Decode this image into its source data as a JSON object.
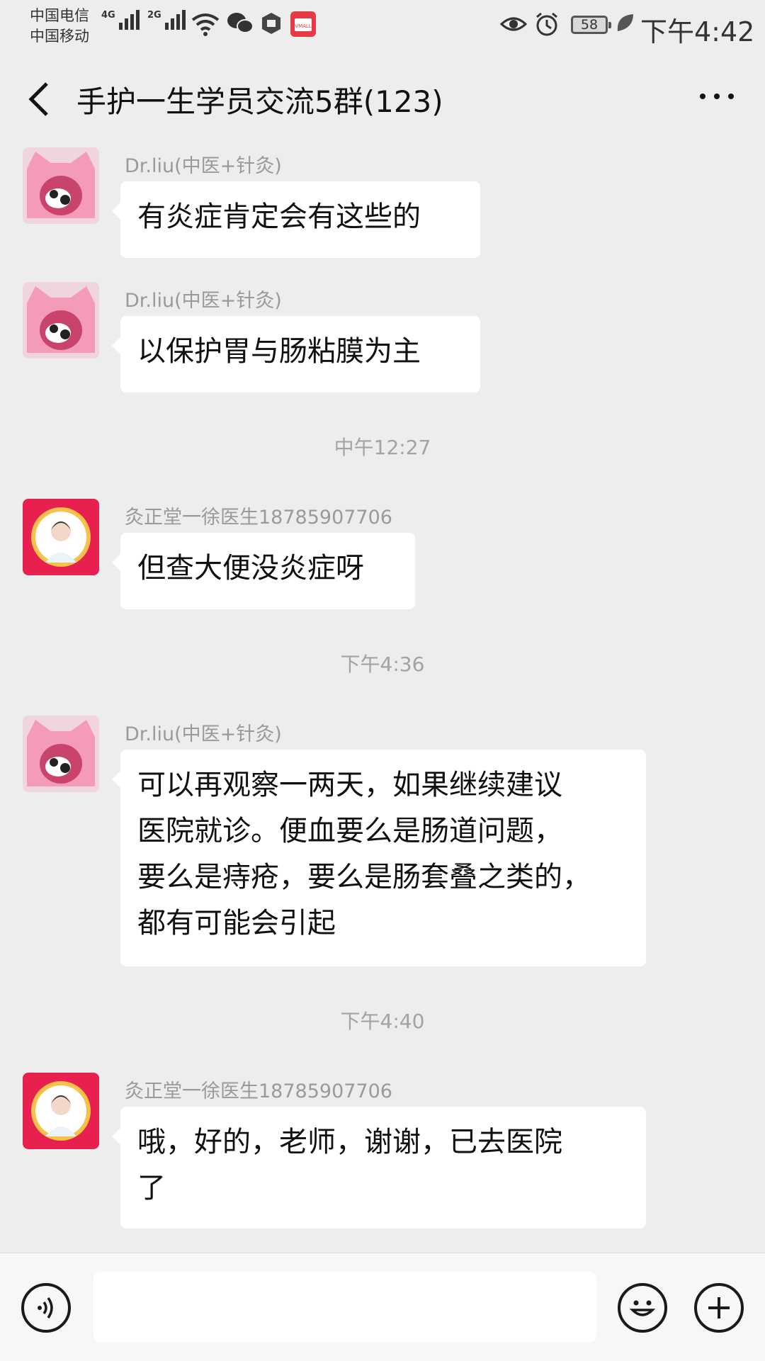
{
  "status_bar": {
    "carrier_1": "中国电信",
    "carrier_2": "中国移动",
    "signal_1_label": "4G",
    "signal_2_label": "2G",
    "battery": "58",
    "time": "下午4:42"
  },
  "header": {
    "title": "手护一生学员交流5群(123)"
  },
  "messages": [
    {
      "sender": "Dr.liu(中医+针灸)",
      "text": "有炎症肯定会有这些的"
    },
    {
      "sender": "Dr.liu(中医+针灸)",
      "text": "以保护胃与肠粘膜为主"
    },
    {
      "sender": "灸正堂一徐医生18785907706",
      "text": "但查大便没炎症呀"
    },
    {
      "sender": "Dr.liu(中医+针灸)",
      "lines": [
        "可以再观察一两天，如果继续建议",
        "医院就诊。便血要么是肠道问题，",
        "要么是痔疮，要么是肠套叠之类的，",
        "都有可能会引起"
      ]
    },
    {
      "sender": "灸正堂一徐医生18785907706",
      "lines": [
        "哦，好的，老师，谢谢，已去医院",
        "了"
      ]
    }
  ],
  "timestamps": [
    "中午12:27",
    "下午4:36",
    "下午4:40"
  ],
  "colors": {
    "background": "#ededed",
    "bubble": "#ffffff",
    "avatar_pink": "#f4a6c0",
    "avatar_red": "#e8204f"
  },
  "icons": {
    "back": "chevron-left-icon",
    "more": "more-dots-icon",
    "voice": "voice-icon",
    "emoji": "emoji-icon",
    "add": "plus-circle-icon"
  }
}
